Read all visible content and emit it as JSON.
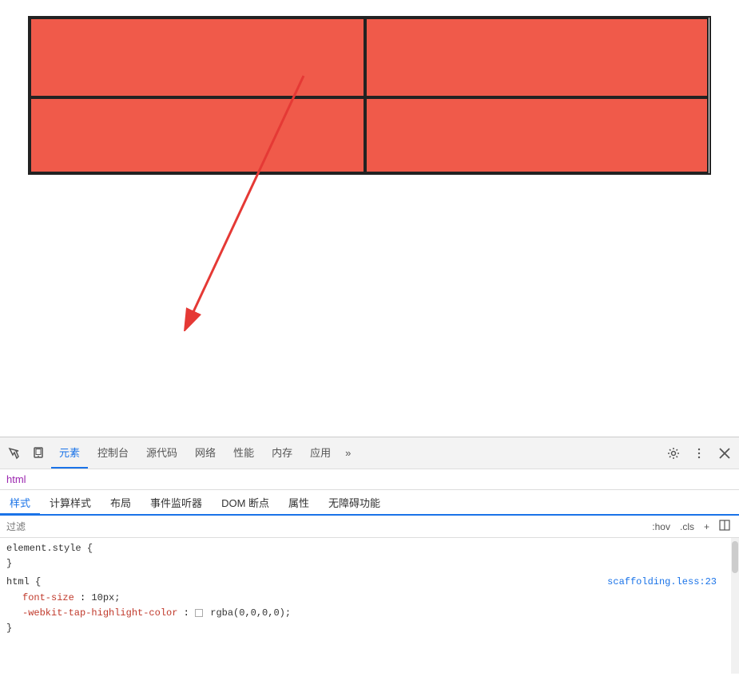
{
  "grid": {
    "color": "#f05a4a",
    "cells": 4
  },
  "arrow": {
    "color": "#e53935"
  },
  "devtools": {
    "toolbar": {
      "tabs": [
        {
          "label": "元素",
          "active": true
        },
        {
          "label": "控制台",
          "active": false
        },
        {
          "label": "源代码",
          "active": false
        },
        {
          "label": "网络",
          "active": false
        },
        {
          "label": "性能",
          "active": false
        },
        {
          "label": "内存",
          "active": false
        },
        {
          "label": "应用",
          "active": false
        }
      ],
      "more_label": "»"
    },
    "breadcrumb": {
      "text": "html"
    },
    "subtabs": [
      {
        "label": "样式",
        "active": true
      },
      {
        "label": "计算样式",
        "active": false
      },
      {
        "label": "布局",
        "active": false
      },
      {
        "label": "事件监听器",
        "active": false
      },
      {
        "label": "DOM 断点",
        "active": false
      },
      {
        "label": "属性",
        "active": false
      },
      {
        "label": "无障碍功能",
        "active": false
      }
    ],
    "filter": {
      "placeholder": "过滤",
      "hov_label": ":hov",
      "cls_label": ".cls"
    },
    "styles": [
      {
        "selector": "element.style {",
        "closing": "}",
        "properties": [],
        "source": ""
      },
      {
        "selector": "html {",
        "closing": "}",
        "properties": [
          {
            "name": "font-size",
            "value": "10px;"
          },
          {
            "name": "-webkit-tap-highlight-color",
            "value": "rgba(0,0,0,0);",
            "has_swatch": true
          }
        ],
        "source": "scaffolding.less:23"
      }
    ]
  }
}
